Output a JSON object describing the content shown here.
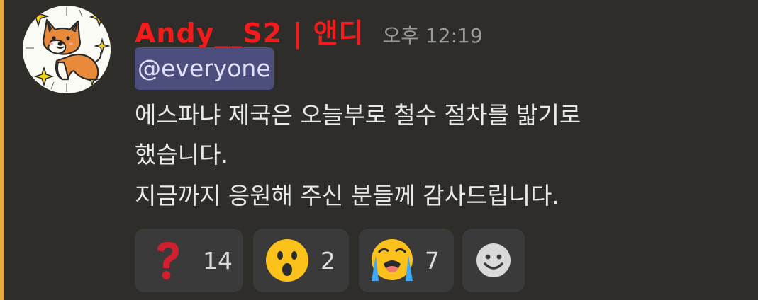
{
  "message": {
    "username": "Andy__S2 | 앤디",
    "timestamp": "오후 12:19",
    "mention": "@everyone",
    "lines": [
      "에스파냐 제국은 오늘부로 철수 절차를 밟기로",
      "했습니다.",
      "지금까지 응원해 주신 분들께 감사드립니다."
    ]
  },
  "reactions": [
    {
      "icon": "question-mark-icon",
      "count": "14"
    },
    {
      "icon": "surprised-face-icon",
      "count": "2"
    },
    {
      "icon": "crying-face-icon",
      "count": "7"
    },
    {
      "icon": "add-reaction-icon"
    }
  ],
  "colors": {
    "username": "#f21c1c",
    "timestamp": "#9a9a9c",
    "mention_bg": "#4c4e7e",
    "mention_text": "#e0e2ff",
    "background": "#2e2d29",
    "mention_bar": "#e8a93b",
    "reaction_bg": "#3a3a3b"
  }
}
